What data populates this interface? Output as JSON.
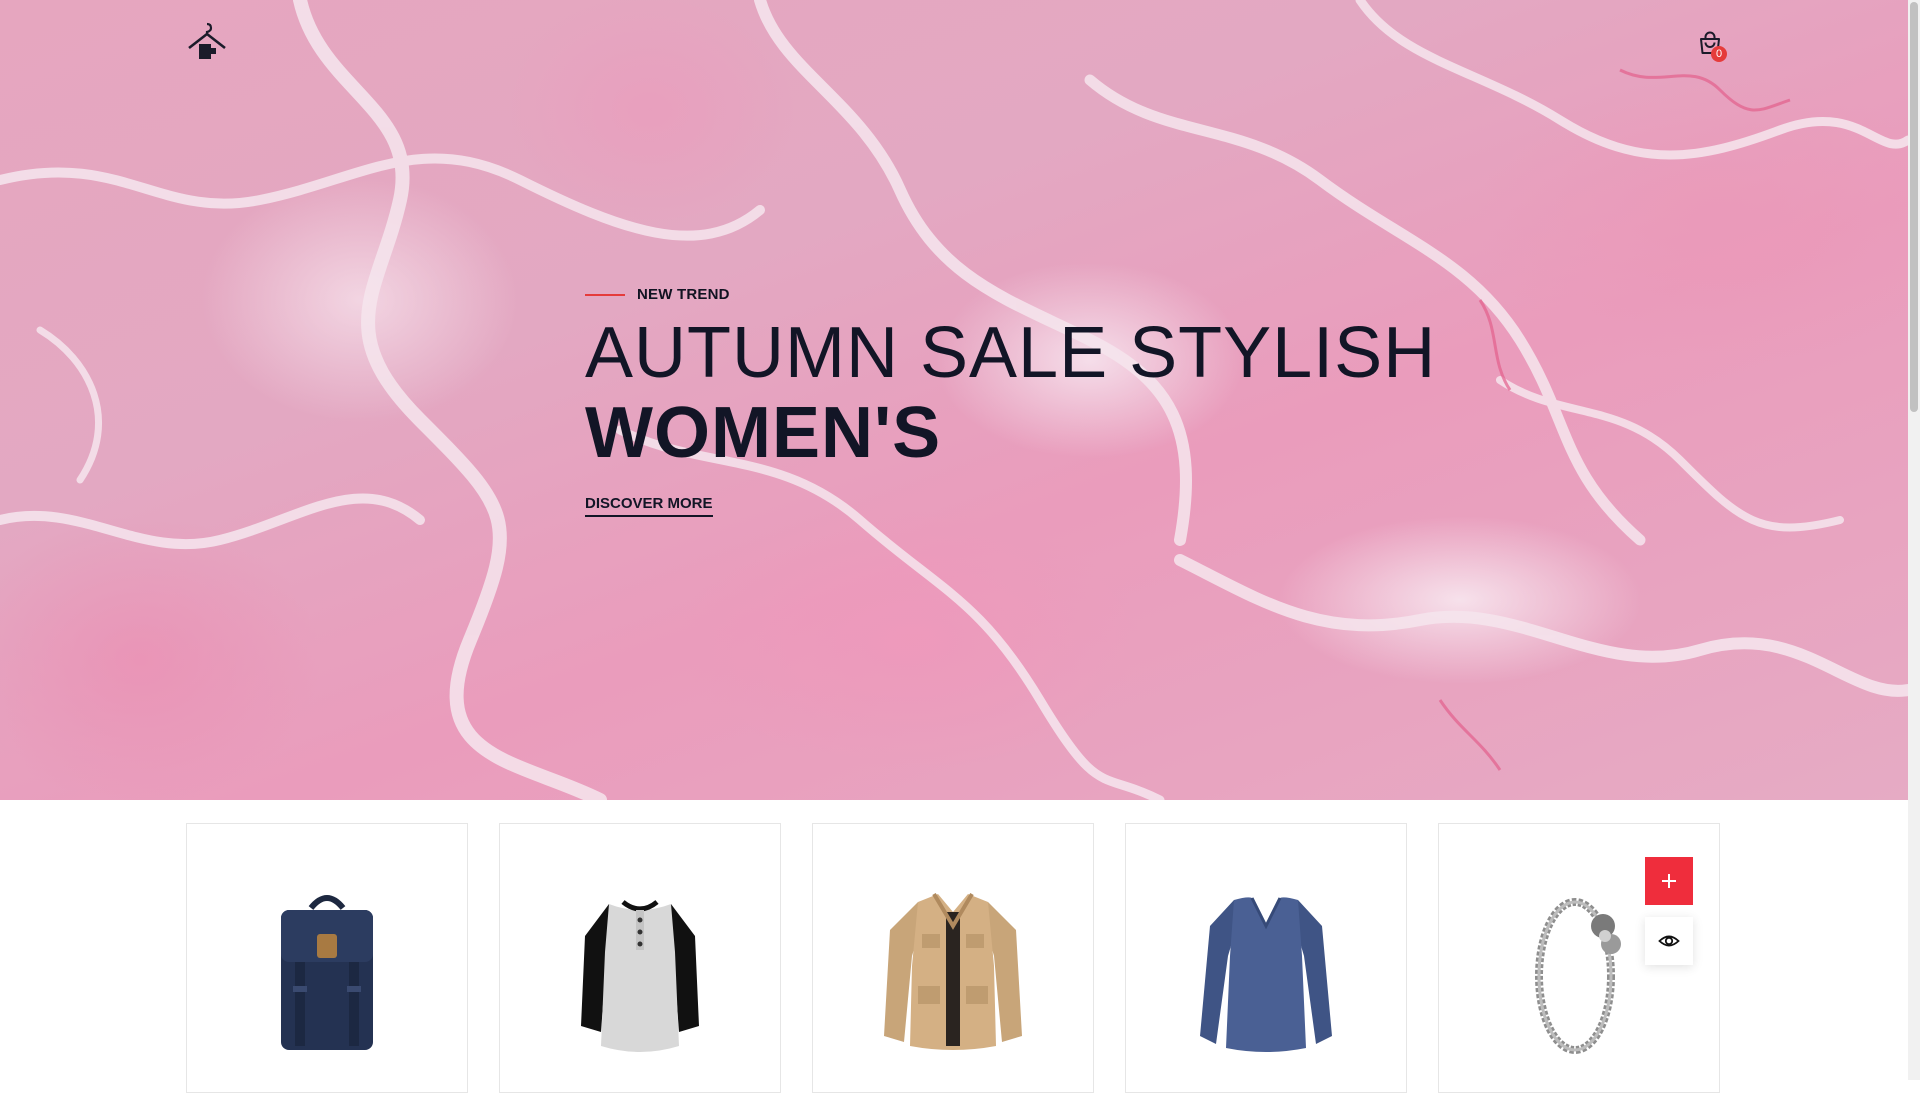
{
  "header": {
    "logo_name": "hanger-home-logo",
    "cart_count": "0"
  },
  "hero": {
    "eyebrow": "NEW TREND",
    "title_light": "AUTUMN SALE STYLISH",
    "title_bold": "WOMEN'S",
    "cta": "DISCOVER MORE",
    "accent_color": "#e53b3b",
    "text_color": "#121526",
    "background": "pink marble"
  },
  "products": [
    {
      "icon": "backpack-image"
    },
    {
      "icon": "raglan-tee-image"
    },
    {
      "icon": "jacket-image"
    },
    {
      "icon": "longsleeve-vneck-image"
    },
    {
      "icon": "bracelet-image"
    }
  ],
  "product_actions": {
    "add_icon": "plus-icon",
    "view_icon": "eye-icon",
    "add_color": "#ef2d3c"
  }
}
